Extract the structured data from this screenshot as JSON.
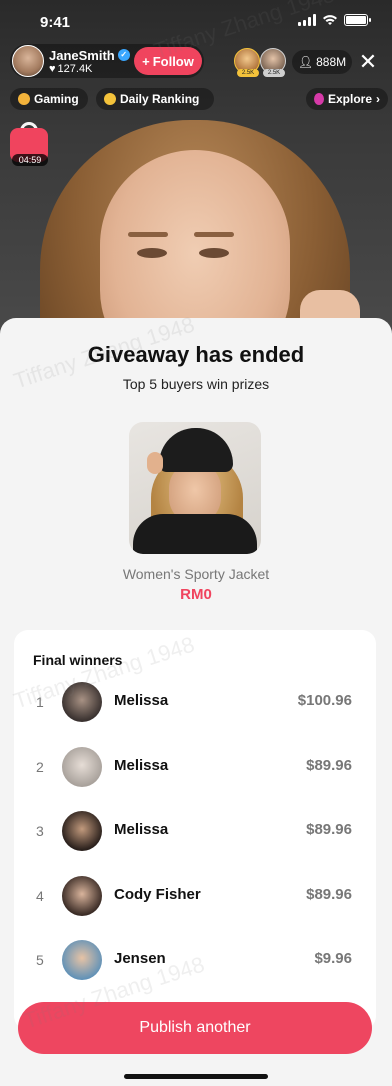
{
  "status_bar": {
    "time": "9:41"
  },
  "host": {
    "name": "JaneSmith",
    "likes": "127.4K",
    "follow_label": "Follow"
  },
  "viewers": {
    "badge_1": "2.5K",
    "badge_2": "2.5K",
    "count": "888M"
  },
  "tags": [
    {
      "label": "Gaming",
      "color": "#f3b33b"
    },
    {
      "label": "Daily Ranking",
      "color": "#f3c23b"
    },
    {
      "label": "Explore",
      "color": "#d63aa8"
    }
  ],
  "shop": {
    "timer": "04:59"
  },
  "watermark": "Tiffany Zhang 1948",
  "giveaway": {
    "title": "Giveaway has ended",
    "subtitle": "Top 5 buyers win prizes",
    "product_name": "Women's Sporty Jacket",
    "product_price": "RM0"
  },
  "winners": {
    "title": "Final winners",
    "rows": [
      {
        "rank": "1",
        "name": "Melissa",
        "amount": "$100.96"
      },
      {
        "rank": "2",
        "name": "Melissa",
        "amount": "$89.96"
      },
      {
        "rank": "3",
        "name": "Melissa",
        "amount": "$89.96"
      },
      {
        "rank": "4",
        "name": "Cody Fisher",
        "amount": "$89.96"
      },
      {
        "rank": "5",
        "name": "Jensen",
        "amount": "$9.96"
      }
    ]
  },
  "actions": {
    "publish_label": "Publish another"
  },
  "colors": {
    "accent": "#ee4660",
    "sheet_bg": "#f4f4f4"
  }
}
